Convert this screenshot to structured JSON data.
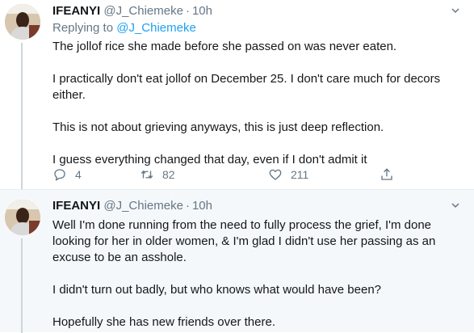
{
  "tweets": [
    {
      "name": "IFEANYI",
      "handle": "@J_Chiemeke",
      "dot": "·",
      "time": "10h",
      "replying_prefix": "Replying to ",
      "replying_to": "@J_Chiemeke",
      "paragraphs": [
        "The jollof rice she made before she passed on was never eaten.",
        "I practically don't eat jollof on December 25. I don't care much for decors either.",
        "This is not about grieving anyways, this is just deep reflection.",
        "I guess everything changed that day, even if I don't admit it"
      ],
      "replies": "4",
      "retweets": "82",
      "likes": "211"
    },
    {
      "name": "IFEANYI",
      "handle": "@J_Chiemeke",
      "dot": "·",
      "time": "10h",
      "paragraphs": [
        "Well I'm done running from the need to fully process the grief, I'm done looking for her in older women, & I'm glad I didn't use her passing as an excuse to be an asshole.",
        "I didn't turn out badly, but who knows what would have been?",
        "Hopefully she has new friends over there."
      ]
    }
  ],
  "icons": {
    "caret": "chevron-down-icon",
    "reply": "reply-icon",
    "retweet": "retweet-icon",
    "like": "heart-icon",
    "share": "share-icon"
  },
  "colors": {
    "text": "#14171a",
    "muted": "#657786",
    "link": "#1da1f2",
    "thread_line": "#ccd6dd",
    "highlight_bg": "#f5f8fa"
  }
}
